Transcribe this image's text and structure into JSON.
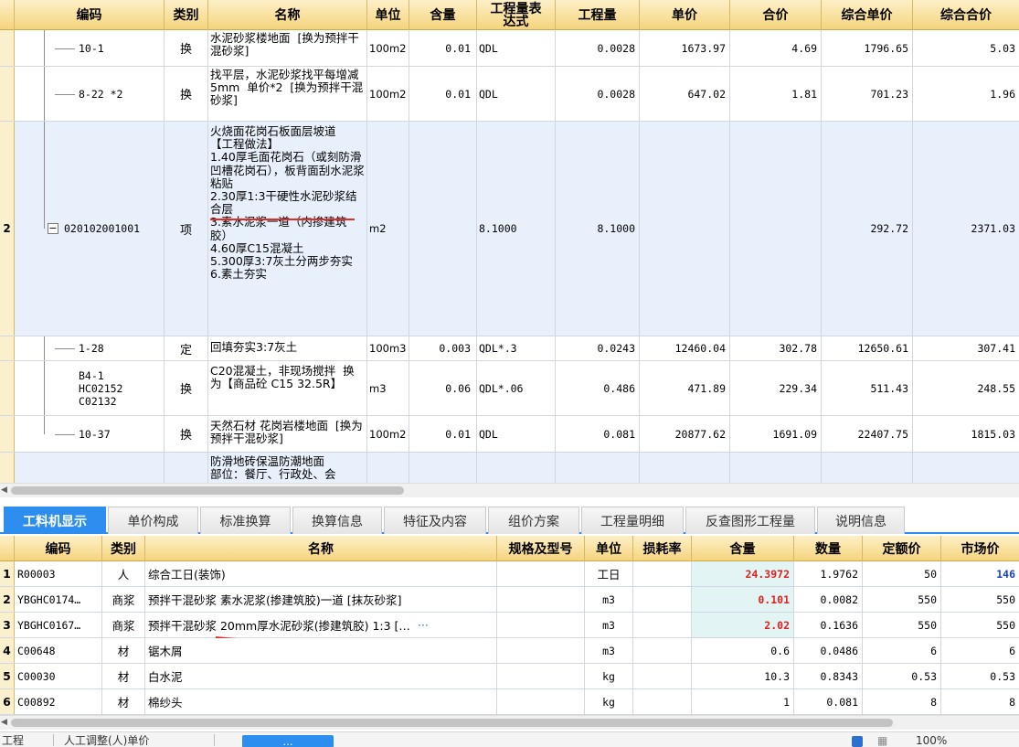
{
  "top_table": {
    "headers": [
      "编码",
      "类别",
      "名称",
      "单位",
      "含量",
      "工程量表\n达式",
      "工程量",
      "单价",
      "合价",
      "综合单价",
      "综合合价"
    ],
    "rows": [
      {
        "num": "",
        "code": "10-1",
        "cat": "换",
        "name": "水泥砂浆楼地面  [换为预拌干混砂浆]",
        "unit": "100m2",
        "content": "0.01",
        "expr": "QDL",
        "qty": "0.0028",
        "price": "1673.97",
        "total": "4.69",
        "comp_price": "1796.65",
        "comp_total": "5.03"
      },
      {
        "num": "",
        "code": "8-22 *2",
        "cat": "换",
        "name": "找平层，水泥砂浆找平每增减5mm  单价*2  [换为预拌干混砂浆]",
        "unit": "100m2",
        "content": "0.01",
        "expr": "QDL",
        "qty": "0.0028",
        "price": "647.02",
        "total": "1.81",
        "comp_price": "701.23",
        "comp_total": "1.96"
      },
      {
        "num": "2",
        "code": "020102001001",
        "cat": "项",
        "name": "火烧面花岗石板面层坡道\n【工程做法】\n1.40厚毛面花岗石（或刻防滑凹槽花岗石），板背面刮水泥浆粘贴\n2.30厚1:3干硬性水泥砂浆结合层\n3.素水泥浆一道（内掺建筑胶）\n4.60厚C15混凝土\n5.300厚3:7灰土分两步夯实\n6.素土夯实",
        "unit": "m2",
        "content": "",
        "expr": "8.1000",
        "qty": "8.1000",
        "price": "",
        "total": "",
        "comp_price": "292.72",
        "comp_total": "2371.03"
      },
      {
        "num": "",
        "code": "1-28",
        "cat": "定",
        "name": "回填夯实3:7灰土",
        "unit": "100m3",
        "content": "0.003",
        "expr": "QDL*.3",
        "qty": "0.0243",
        "price": "12460.04",
        "total": "302.78",
        "comp_price": "12650.61",
        "comp_total": "307.41"
      },
      {
        "num": "",
        "code": "B4-1 HC02152 C02132",
        "cat": "换",
        "name": "C20混凝土，非现场搅拌  换为【商品砼 C15 32.5R】",
        "unit": "m3",
        "content": "0.06",
        "expr": "QDL*.06",
        "qty": "0.486",
        "price": "471.89",
        "total": "229.34",
        "comp_price": "511.43",
        "comp_total": "248.55"
      },
      {
        "num": "",
        "code": "10-37",
        "cat": "换",
        "name": "天然石材 花岗岩楼地面  [换为预拌干混砂浆]",
        "unit": "100m2",
        "content": "0.01",
        "expr": "QDL",
        "qty": "0.081",
        "price": "20877.62",
        "total": "1691.09",
        "comp_price": "22407.75",
        "comp_total": "1815.03"
      },
      {
        "num": "",
        "code": "",
        "cat": "",
        "name": "防滑地砖保温防潮地面\n部位：餐厅、行政处、会",
        "unit": "",
        "content": "",
        "expr": "",
        "qty": "",
        "price": "",
        "total": "",
        "comp_price": "",
        "comp_total": ""
      }
    ]
  },
  "tabs": [
    "工料机显示",
    "单价构成",
    "标准换算",
    "换算信息",
    "特征及内容",
    "组价方案",
    "工程量明细",
    "反查图形工程量",
    "说明信息"
  ],
  "bottom_table": {
    "headers": [
      "编码",
      "类别",
      "名称",
      "规格及型号",
      "单位",
      "损耗率",
      "含量",
      "数量",
      "定额价",
      "市场价"
    ],
    "rows": [
      {
        "num": "1",
        "code": "R00003",
        "cat": "人",
        "name": "综合工日(装饰)",
        "spec": "",
        "unit": "工日",
        "loss": "",
        "content": "24.3972",
        "qty": "1.9762",
        "quota": "50",
        "market": "146"
      },
      {
        "num": "2",
        "code": "YBGHC0174…",
        "cat": "商浆",
        "name": "预拌干混砂浆 素水泥浆(掺建筑胶)一道  [抹灰砂浆]",
        "spec": "",
        "unit": "m3",
        "loss": "",
        "content": "0.101",
        "qty": "0.0082",
        "quota": "550",
        "market": "550"
      },
      {
        "num": "3",
        "code": "YBGHC0167…",
        "cat": "商浆",
        "name": "预拌干混砂浆 20mm厚水泥砂浆(掺建筑胶) 1:3  […",
        "spec": "",
        "unit": "m3",
        "loss": "",
        "content": "2.02",
        "qty": "0.1636",
        "quota": "550",
        "market": "550"
      },
      {
        "num": "4",
        "code": "C00648",
        "cat": "材",
        "name": "锯木屑",
        "spec": "",
        "unit": "m3",
        "loss": "",
        "content": "0.6",
        "qty": "0.0486",
        "quota": "6",
        "market": "6"
      },
      {
        "num": "5",
        "code": "C00030",
        "cat": "材",
        "name": "白水泥",
        "spec": "",
        "unit": "kg",
        "loss": "",
        "content": "10.3",
        "qty": "0.8343",
        "quota": "0.53",
        "market": "0.53"
      },
      {
        "num": "6",
        "code": "C00892",
        "cat": "材",
        "name": "棉纱头",
        "spec": "",
        "unit": "kg",
        "loss": "",
        "content": "1",
        "qty": "0.081",
        "quota": "8",
        "market": "8"
      }
    ],
    "more_label": "···"
  },
  "statusbar": {
    "left": "工程",
    "middle": "人工调整(人)单价",
    "button": "…",
    "right": "100%"
  },
  "colors": {
    "header_bg": "#f5d47d",
    "tab_active": "#2d8ef0",
    "red_value": "#e01f1f",
    "blue_value": "#1a3fd1",
    "selected_row": "#e8f1fb"
  }
}
